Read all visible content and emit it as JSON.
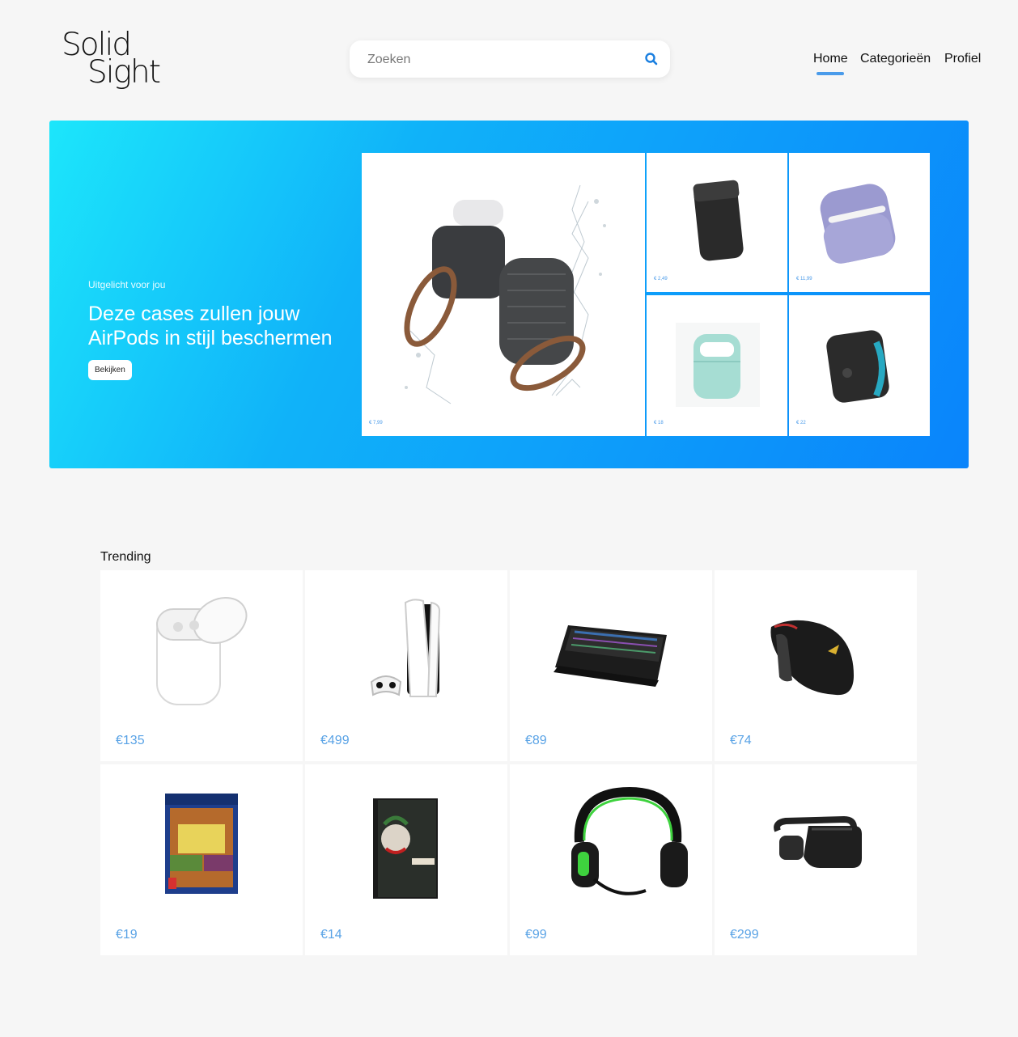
{
  "brand": {
    "line1": "Solid",
    "line2": "Sight"
  },
  "search": {
    "placeholder": "Zoeken"
  },
  "nav": {
    "items": [
      {
        "label": "Home",
        "active": true
      },
      {
        "label": "Categorieën"
      },
      {
        "label": "Profiel"
      }
    ]
  },
  "hero": {
    "eyebrow": "Uitgelicht voor jou",
    "title": "Deze cases zullen jouw AirPods in stijl beschermen",
    "button_label": "Bekijken",
    "tiles": [
      {
        "price": "€ 7,99",
        "icon": "airpods-rugged-case-icon"
      },
      {
        "price": "€ 2,49",
        "icon": "leather-pouch-icon"
      },
      {
        "price": "€ 11,99",
        "icon": "lavender-case-icon"
      },
      {
        "price": "€ 18",
        "icon": "mint-case-icon"
      },
      {
        "price": "€ 22",
        "icon": "zip-pouch-icon"
      }
    ]
  },
  "trending": {
    "title": "Trending",
    "products": [
      {
        "price": "€135",
        "icon": "airpods-icon"
      },
      {
        "price": "€499",
        "icon": "playstation-console-icon"
      },
      {
        "price": "€89",
        "icon": "keyboard-icon"
      },
      {
        "price": "€74",
        "icon": "gaming-mouse-icon"
      },
      {
        "price": "€19",
        "icon": "game-box-icon"
      },
      {
        "price": "€14",
        "icon": "movie-box-icon"
      },
      {
        "price": "€99",
        "icon": "headset-icon"
      },
      {
        "price": "€299",
        "icon": "vr-headset-icon"
      }
    ]
  },
  "colors": {
    "accent": "#4a9bea",
    "price": "#5aa3e6",
    "hero_start": "#1ce6fb",
    "hero_end": "#0a84fb",
    "background": "#f6f6f6"
  }
}
